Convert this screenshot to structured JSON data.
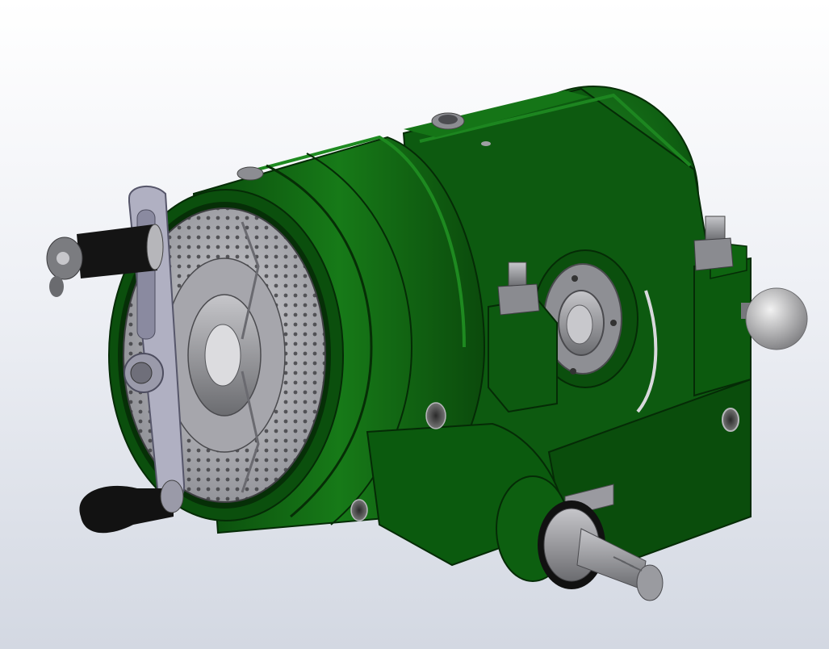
{
  "viewport": {
    "background_top": "#ffffff",
    "background_bottom": "#d3d8e2"
  },
  "model": {
    "body_color": "#0f5f12",
    "body_dark": "#073d09",
    "body_light": "#1f7f20",
    "metal_color": "#a9a9ad",
    "metal_dark": "#5f6064",
    "handle_color": "#151515",
    "plate_color": "#a9a9b8",
    "icon": "dividing-head-model-icon"
  }
}
